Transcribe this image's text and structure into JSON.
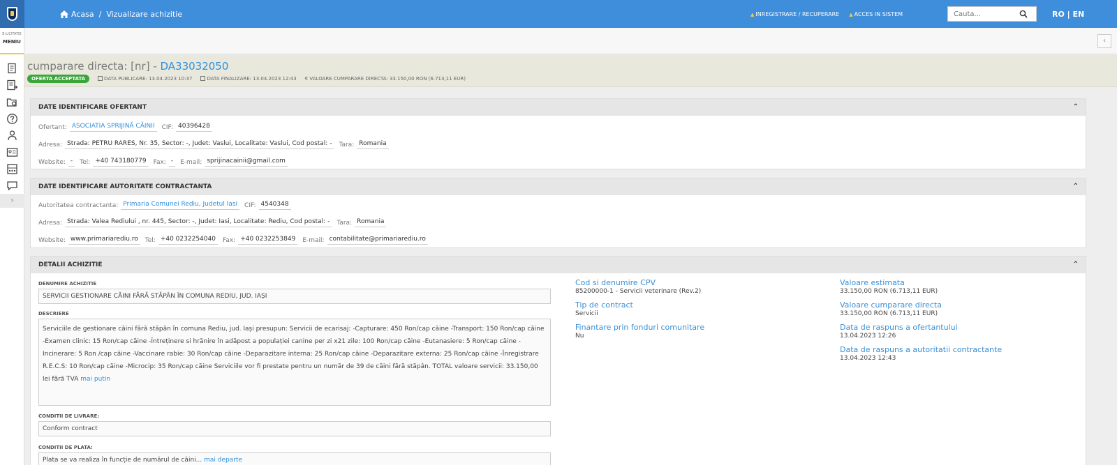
{
  "header": {
    "breadcrumb_home": "Acasa",
    "breadcrumb_sep": "/",
    "breadcrumb_current": "Vizualizare achizitie",
    "link_register": "INREGISTRARE / RECUPERARE",
    "link_login": "ACCES IN SISTEM",
    "search_placeholder": "Cauta...",
    "lang": "RO | EN"
  },
  "sidebar": {
    "brand_small": "E-LICITATIE",
    "menu_label": "MENIU",
    "icons": [
      "documents-icon",
      "list-export-icon",
      "folder-settings-icon",
      "help-icon",
      "user-icon",
      "id-card-icon",
      "calculator-icon",
      "chat-icon"
    ],
    "expand": "›"
  },
  "subheader": {
    "collapse": "‹"
  },
  "procurement": {
    "title_prefix": "cumparare directa: [nr] - ",
    "code": "DA33032050",
    "status": "OFERTA ACCEPTATA",
    "publish_date": "DATA PUBLICARE: 13.04.2023 10:37",
    "end_date": "DATA FINALIZARE: 13.04.2023 12:43",
    "value": "€ VALOARE CUMPARARE DIRECTA: 33.150,00  RON (6.713,11  EUR)"
  },
  "bidder": {
    "heading": "DATE IDENTIFICARE OFERTANT",
    "ofertant_label": "Ofertant:",
    "ofertant": "ASOCIATIA SPRIJINĂ CĂINII",
    "cif_label": "CIF:",
    "cif": "40396428",
    "adresa_label": "Adresa:",
    "adresa": "Strada: PETRU RARES, Nr. 35, Sector: -, Judet: Vaslui, Localitate: Vaslui, Cod postal: -",
    "tara_label": "Tara:",
    "tara": "Romania",
    "website_label": "Website:",
    "website": "-",
    "tel_label": "Tel:",
    "tel": "+40 743180779",
    "fax_label": "Fax:",
    "fax": "-",
    "email_label": "E-mail:",
    "email": "sprijinacainii@gmail.com"
  },
  "authority": {
    "heading": "DATE IDENTIFICARE AUTORITATE CONTRACTANTA",
    "name_label": "Autoritatea contractanta:",
    "name": "Primaria Comunei Rediu, Judetul Iasi",
    "cif_label": "CIF:",
    "cif": "4540348",
    "adresa_label": "Adresa:",
    "adresa": "Strada: Valea Rediului , nr. 445, Sector: -, Judet: Iasi, Localitate: Rediu, Cod postal: -",
    "tara_label": "Tara:",
    "tara": "Romania",
    "website_label": "Website:",
    "website": "www.primariarediu.ro",
    "tel_label": "Tel:",
    "tel": "+40 0232254040",
    "fax_label": "Fax:",
    "fax": "+40 0232253849",
    "email_label": "E-mail:",
    "email": "contabilitate@primariarediu.ro"
  },
  "details": {
    "heading": "DETALII ACHIZITIE",
    "name_label": "DENUMIRE ACHIZITIE",
    "name": "SERVICII GESTIONARE CĂINI FĂRĂ STĂPÂN ÎN COMUNA REDIU, JUD. IAȘI",
    "desc_label": "DESCRIERE",
    "desc": "Serviciile de gestionare căini fără stăpân în comuna Rediu, jud. Iași presupun: Servicii de ecarisaj: -Capturare: 450 Ron/cap căine -Transport: 150 Ron/cap căine -Examen clinic: 15 Ron/cap căine -Întreținere si hrănire în adăpost a populației canine per zi x21 zile: 100 Ron/cap căine -Eutanasiere: 5 Ron/cap căine -Incinerare: 5 Ron /cap căine -Vaccinare rabie: 30 Ron/cap căine -Deparazitare interna: 25 Ron/cap căine -Deparazitare externa: 25 Ron/cap căine -Înregistrare R.E.C.S: 10 Ron/cap căine -Microcip: 35 Ron/cap căine Serviciile vor fi prestate pentru un număr de 39 de căini fără stăpân. TOTAL valoare servicii: 33.150,00 lei fără TVA",
    "desc_less": "mai putin",
    "delivery_label": "CONDITII DE LIVRARE:",
    "delivery": "Conform contract",
    "payment_label": "CONDITII DE PLATA:",
    "payment": "Plata se va realiza în funcție de numărul de căini...",
    "payment_more": "mai departe",
    "cpv_label": "Cod si denumire CPV",
    "cpv": "85200000-1 - Servicii veterinare (Rev.2)",
    "contract_type_label": "Tip de contract",
    "contract_type": "Servicii",
    "eu_funds_label": "Finantare prin fonduri comunitare",
    "eu_funds": "Nu",
    "estimated_label": "Valoare estimata",
    "estimated": "33.150,00  RON (6.713,11  EUR)",
    "direct_value_label": "Valoare cumparare directa",
    "direct_value": "33.150,00  RON (6.713,11  EUR)",
    "bidder_response_label": "Data de raspuns a ofertantului",
    "bidder_response": "13.04.2023 12:26",
    "authority_response_label": "Data de raspuns a autoritatii contractante",
    "authority_response": "13.04.2023 12:43"
  }
}
